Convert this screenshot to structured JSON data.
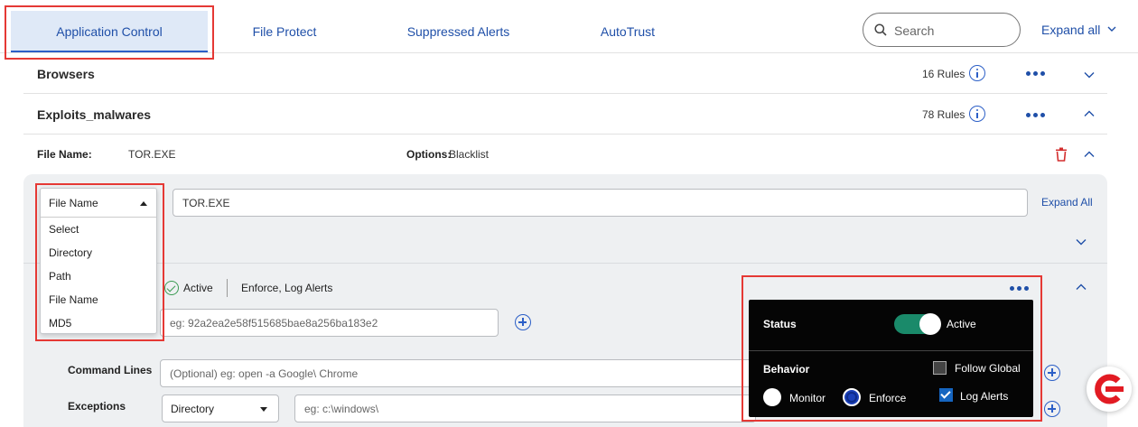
{
  "tabs": [
    {
      "label": "Application Control",
      "active": true
    },
    {
      "label": "File Protect",
      "active": false
    },
    {
      "label": "Suppressed Alerts",
      "active": false
    },
    {
      "label": "AutoTrust",
      "active": false
    }
  ],
  "search": {
    "placeholder": "Search",
    "icon": "search-icon"
  },
  "header": {
    "expand_all": "Expand all"
  },
  "groups": [
    {
      "name": "Browsers",
      "rules": "16 Rules",
      "expanded": false
    },
    {
      "name": "Exploits_malwares",
      "rules": "78 Rules",
      "expanded": true
    }
  ],
  "rule": {
    "file_name_label": "File Name:",
    "file_name_value": "TOR.EXE",
    "options_label": "Options:",
    "options_value": "Blacklist"
  },
  "editor": {
    "type_selected": "File Name",
    "type_options": [
      "Select",
      "Directory",
      "Path",
      "File Name",
      "MD5"
    ],
    "value": "TOR.EXE",
    "expand_all": "Expand All",
    "status_text": "Active",
    "behavior_text": "Enforce, Log Alerts",
    "md5_placeholder": "eg: 92a2ea2e58f515685bae8a256ba183e2",
    "command_lines_label": "Command Lines",
    "command_lines_placeholder": "(Optional) eg: open -a Google\\ Chrome",
    "exceptions_label": "Exceptions",
    "exceptions_type": "Directory",
    "exceptions_placeholder": "eg: c:\\windows\\"
  },
  "popup": {
    "status_label": "Status",
    "status_value": "Active",
    "status_on": true,
    "behavior_label": "Behavior",
    "follow_global": "Follow Global",
    "follow_global_checked": false,
    "monitor": "Monitor",
    "enforce": "Enforce",
    "selected_behavior": "Enforce",
    "log_alerts": "Log Alerts",
    "log_alerts_checked": true
  },
  "colors": {
    "accent": "#1f4fa8",
    "toggle": "#1a8a6a",
    "highlight": "#e53935",
    "delete": "#d32f2f"
  }
}
